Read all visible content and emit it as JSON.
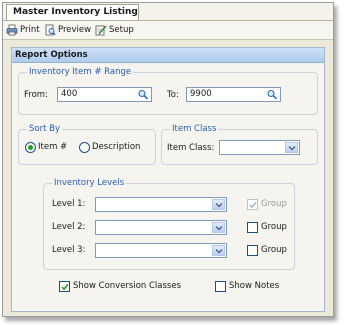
{
  "window": {
    "tab_title": "Master Inventory Listing",
    "toolbar": {
      "print": "Print",
      "preview": "Preview",
      "setup": "Setup"
    }
  },
  "panel": {
    "title": "Report Options",
    "item_range": {
      "legend": "Inventory Item # Range",
      "from_label": "From:",
      "from_value": "400",
      "to_label": "To:",
      "to_value": "9900"
    },
    "sort_by": {
      "legend": "Sort By",
      "item_option": "Item #",
      "description_option": "Description",
      "selected": "Item #"
    },
    "item_class": {
      "legend": "Item Class",
      "label": "Item Class:",
      "value": ""
    },
    "inventory_levels": {
      "legend": "Inventory Levels",
      "rows": [
        {
          "label": "Level 1:",
          "value": "",
          "group_label": "Group",
          "group_checked": true,
          "group_enabled": false
        },
        {
          "label": "Level 2:",
          "value": "",
          "group_label": "Group",
          "group_checked": false,
          "group_enabled": true
        },
        {
          "label": "Level 3:",
          "value": "",
          "group_label": "Group",
          "group_checked": false,
          "group_enabled": true
        }
      ]
    },
    "show_conversion_classes": {
      "label": "Show Conversion Classes",
      "checked": true
    },
    "show_notes": {
      "label": "Show Notes",
      "checked": false
    }
  },
  "colors": {
    "group_title": "#2a5db0",
    "panel_header": "#aecbef",
    "accent_border": "#7f9db9"
  },
  "icons": {
    "print": "printer-icon",
    "preview": "preview-icon",
    "setup": "setup-icon",
    "lookup": "search-icon",
    "dropdown": "chevron-down-icon",
    "check": "checkmark-icon"
  }
}
